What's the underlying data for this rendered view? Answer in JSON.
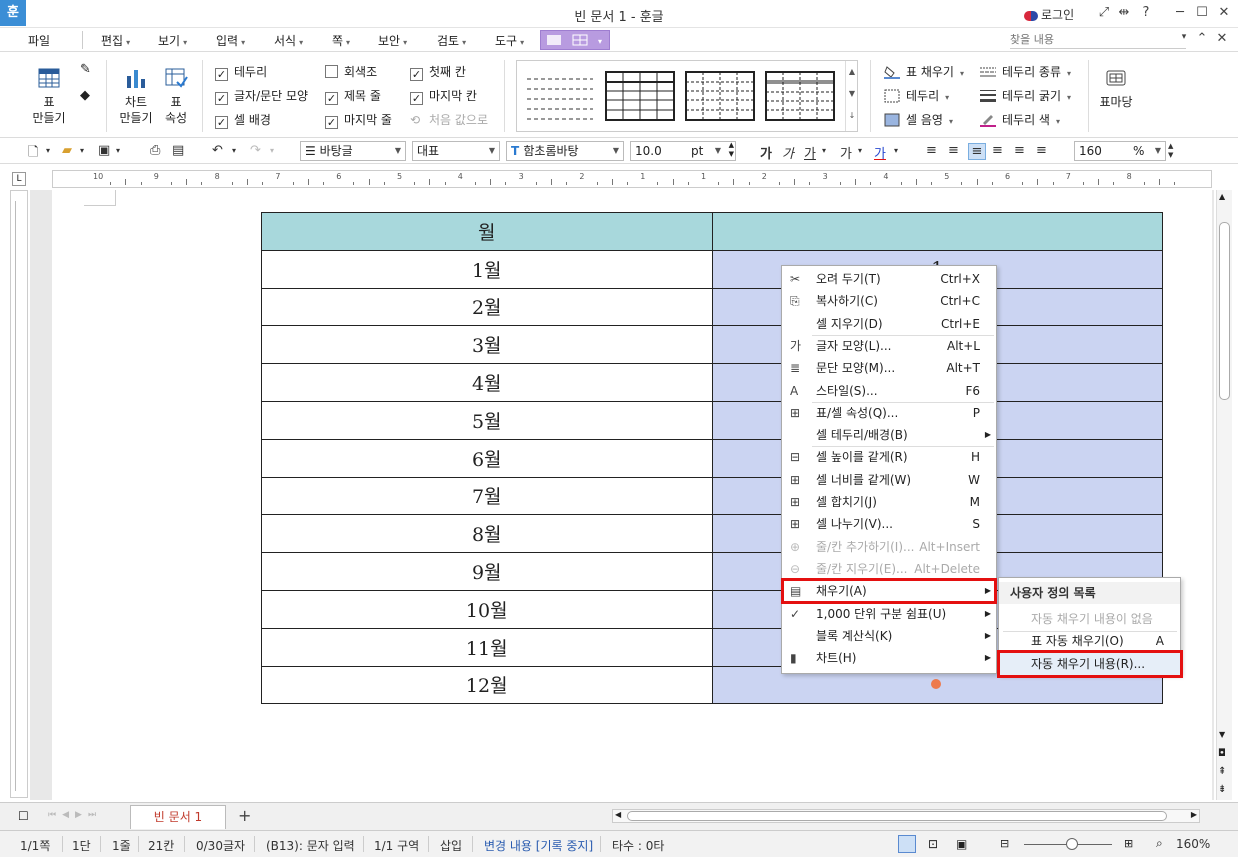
{
  "window": {
    "title": "빈 문서 1 - 훈글",
    "app_logo": "훈",
    "login": "로그인"
  },
  "menu": {
    "file": "파일",
    "items": [
      "편집",
      "보기",
      "입력",
      "서식",
      "쪽",
      "보안",
      "검토",
      "도구"
    ],
    "search_placeholder": "찾을 내용"
  },
  "ribbon": {
    "table_make": "표\n만들기",
    "chart_make": "차트\n만들기",
    "table_props": "표\n속성",
    "checks": [
      {
        "label": "테두리",
        "checked": true
      },
      {
        "label": "글자/문단 모양",
        "checked": true
      },
      {
        "label": "셀 배경",
        "checked": true
      },
      {
        "label": "회색조",
        "checked": false
      },
      {
        "label": "제목 줄",
        "checked": true
      },
      {
        "label": "마지막 줄",
        "checked": true
      },
      {
        "label": "첫째 칸",
        "checked": true
      },
      {
        "label": "마지막 칸",
        "checked": true
      },
      {
        "label": "처음 값으로",
        "checked": false,
        "disabled": true
      }
    ],
    "fill": "표 채우기",
    "border": "테두리",
    "cell_shade": "셀 음영",
    "border_type": "테두리 종류",
    "border_width": "테두리 굵기",
    "border_color": "테두리 색",
    "table_pour": "표마당"
  },
  "toolbar": {
    "style": "바탕글",
    "lang": "대표",
    "font": "함초롬바탕",
    "size": "10.0",
    "size_unit": "pt",
    "zoom": "160",
    "zoom_unit": "%"
  },
  "ruler": [
    "10",
    "9",
    "8",
    "7",
    "6",
    "5",
    "4",
    "3",
    "2",
    "1",
    "1",
    "2",
    "3",
    "4",
    "5",
    "6",
    "7",
    "8"
  ],
  "table": {
    "header": [
      "월",
      ""
    ],
    "rows": [
      [
        "1월",
        "1"
      ],
      [
        "2월",
        ""
      ],
      [
        "3월",
        ""
      ],
      [
        "4월",
        ""
      ],
      [
        "5월",
        ""
      ],
      [
        "6월",
        ""
      ],
      [
        "7월",
        ""
      ],
      [
        "8월",
        ""
      ],
      [
        "9월",
        ""
      ],
      [
        "10월",
        ""
      ],
      [
        "11월",
        ""
      ],
      [
        "12월",
        ""
      ]
    ]
  },
  "context_menu": [
    {
      "label": "오려 두기(T)",
      "shortcut": "Ctrl+X",
      "icon": "scissors-icon"
    },
    {
      "label": "복사하기(C)",
      "shortcut": "Ctrl+C",
      "icon": "copy-icon"
    },
    {
      "label": "셀 지우기(D)",
      "shortcut": "Ctrl+E",
      "icon": ""
    },
    {
      "label": "글자 모양(L)...",
      "shortcut": "Alt+L",
      "icon": "char-shape-icon"
    },
    {
      "label": "문단 모양(M)...",
      "shortcut": "Alt+T",
      "icon": "para-shape-icon"
    },
    {
      "label": "스타일(S)...",
      "shortcut": "F6",
      "icon": "style-icon"
    },
    {
      "label": "표/셀 속성(Q)...",
      "shortcut": "P",
      "icon": "table-props-icon"
    },
    {
      "label": "셀 테두리/배경(B)",
      "shortcut": "",
      "icon": "",
      "sub": true
    },
    {
      "label": "셀 높이를 같게(R)",
      "shortcut": "H",
      "icon": "equal-height-icon"
    },
    {
      "label": "셀 너비를 같게(W)",
      "shortcut": "W",
      "icon": "equal-width-icon"
    },
    {
      "label": "셀 합치기(J)",
      "shortcut": "M",
      "icon": "merge-cells-icon"
    },
    {
      "label": "셀 나누기(V)...",
      "shortcut": "S",
      "icon": "split-cells-icon"
    },
    {
      "label": "줄/칸 추가하기(I)...",
      "shortcut": "Alt+Insert",
      "icon": "add-row-icon",
      "disabled": true
    },
    {
      "label": "줄/칸 지우기(E)...",
      "shortcut": "Alt+Delete",
      "icon": "delete-row-icon",
      "disabled": true
    },
    {
      "label": "채우기(A)",
      "shortcut": "",
      "icon": "fill-icon",
      "sub": true
    },
    {
      "label": "1,000 단위 구분 쉼표(U)",
      "shortcut": "",
      "icon": "thousand-sep-icon",
      "sub": true
    },
    {
      "label": "블록 계산식(K)",
      "shortcut": "",
      "icon": "",
      "sub": true
    },
    {
      "label": "차트(H)",
      "shortcut": "",
      "icon": "chart-icon",
      "sub": true
    }
  ],
  "submenu": {
    "header": "사용자 정의 목록",
    "empty": "자동 채우기 내용이 없음",
    "table_autofill": "표 자동 채우기(O)",
    "table_autofill_key": "A",
    "autofill_content": "자동 채우기 내용(R)..."
  },
  "tabs": {
    "doc_tab": "빈 문서 1",
    "add": "+"
  },
  "status": [
    "1/1쪽",
    "1단",
    "1줄",
    "21칸",
    "0/30글자",
    "(B13): 문자 입력",
    "1/1 구역",
    "삽입",
    "변경 내용 [기록 중지]",
    "타수 : 0타"
  ],
  "status_zoom": "160%",
  "colors": {
    "header_fill": "#a8d8dc",
    "selected_fill": "#cbd4f2",
    "highlight": "#e41010"
  }
}
